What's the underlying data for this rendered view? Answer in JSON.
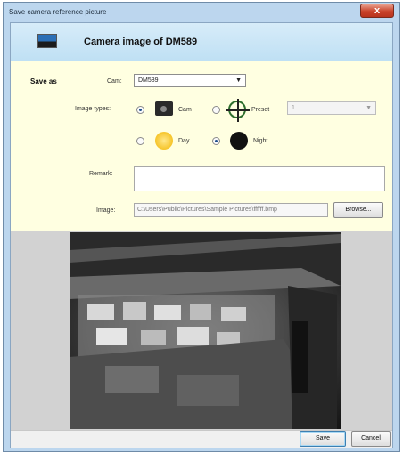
{
  "window": {
    "title": "Save camera reference picture",
    "close_glyph": "x"
  },
  "header": {
    "title": "Camera image of DM589",
    "icon": "camera-picture-icon"
  },
  "form": {
    "save_as_label": "Save as",
    "cam_label": "Cam:",
    "cam_value": "DM589",
    "image_types_label": "Image types:",
    "option_cam": "Cam",
    "option_preset": "Preset",
    "preset_value": "1",
    "option_day": "Day",
    "option_night": "Night",
    "selected_type": "Cam",
    "selected_time": "Night",
    "remark_label": "Remark:",
    "remark_value": "",
    "image_label": "Image:",
    "image_path": "C:\\Users\\Public\\Pictures\\Sample Pictures\\ffffff.bmp",
    "browse_label": "Browse..."
  },
  "footer": {
    "save_label": "Save",
    "cancel_label": "Cancel"
  }
}
